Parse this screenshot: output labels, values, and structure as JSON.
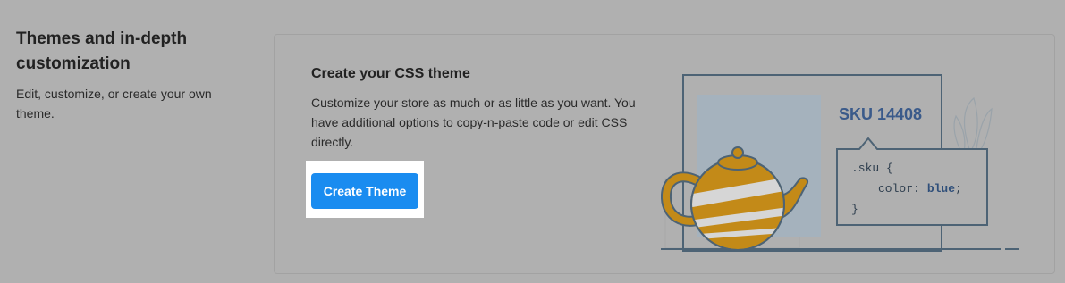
{
  "section": {
    "title": "Themes and in-depth customization",
    "description": "Edit, customize, or create your own theme."
  },
  "card": {
    "title": "Create your CSS theme",
    "description": "Customize your store as much or as little as you want. You have additional options to copy-n-paste code or edit CSS directly.",
    "button_label": "Create Theme"
  },
  "illustration": {
    "sku_label": "SKU 14408",
    "code_line1": ".sku {",
    "code_line2_prop": "color:",
    "code_line2_value": "blue",
    "code_line2_end": ";",
    "code_line3": "}"
  },
  "colors": {
    "background": "#b0b0b0",
    "button": "#1a8cf0",
    "button_text": "#ffffff",
    "teapot": "#c38a18",
    "line": "#4d6375",
    "sku_text": "#3a5a8a"
  }
}
